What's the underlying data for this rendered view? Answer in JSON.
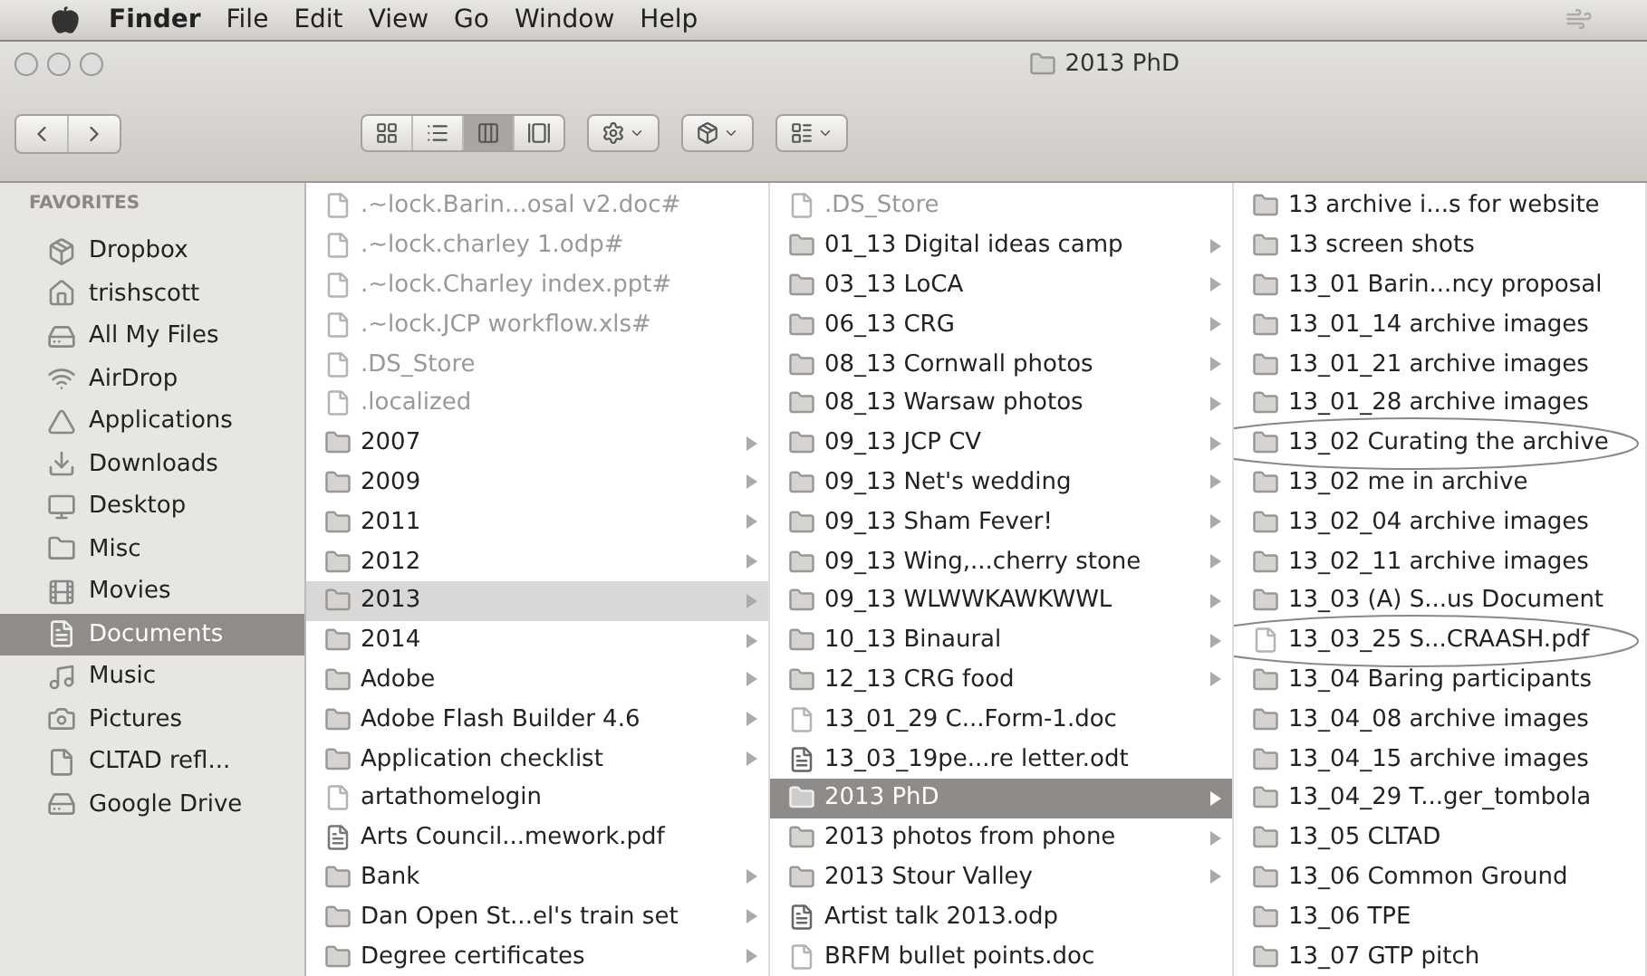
{
  "menu_bar": {
    "items": [
      {
        "label": "Finder",
        "kind": "app"
      },
      {
        "label": "File",
        "kind": "menu"
      },
      {
        "label": "Edit",
        "kind": "menu"
      },
      {
        "label": "View",
        "kind": "menu"
      },
      {
        "label": "Go",
        "kind": "menu"
      },
      {
        "label": "Window",
        "kind": "menu"
      },
      {
        "label": "Help",
        "kind": "menu"
      }
    ]
  },
  "window": {
    "title": "2013 PhD"
  },
  "toolbar": {
    "view_modes": [
      {
        "selected": false
      },
      {
        "selected": false
      },
      {
        "selected": true
      },
      {
        "selected": false
      }
    ]
  },
  "sidebar": {
    "heading": "FAVORITES",
    "items": [
      {
        "label": "Dropbox",
        "selected": false
      },
      {
        "label": "trishscott",
        "selected": false
      },
      {
        "label": "All My Files",
        "selected": false
      },
      {
        "label": "AirDrop",
        "selected": false
      },
      {
        "label": "Applications",
        "selected": false
      },
      {
        "label": "Downloads",
        "selected": false
      },
      {
        "label": "Desktop",
        "selected": false
      },
      {
        "label": "Misc",
        "selected": false
      },
      {
        "label": "Movies",
        "selected": false
      },
      {
        "label": "Documents",
        "selected": true
      },
      {
        "label": "Music",
        "selected": false
      },
      {
        "label": "Pictures",
        "selected": false
      },
      {
        "label": "CLTAD refl...",
        "selected": false
      },
      {
        "label": "Google Drive",
        "selected": false
      }
    ]
  },
  "columns": [
    {
      "focused": false,
      "items": [
        {
          "name": ".~lock.Barin...osal v2.doc#",
          "kind": "file",
          "dimmed": true,
          "selected": false
        },
        {
          "name": ".~lock.charley 1.odp#",
          "kind": "file",
          "dimmed": true,
          "selected": false
        },
        {
          "name": ".~lock.Charley index.ppt#",
          "kind": "file",
          "dimmed": true,
          "selected": false
        },
        {
          "name": ".~lock.JCP workflow.xls#",
          "kind": "file",
          "dimmed": true,
          "selected": false
        },
        {
          "name": ".DS_Store",
          "kind": "file",
          "dimmed": true,
          "selected": false
        },
        {
          "name": ".localized",
          "kind": "file",
          "dimmed": true,
          "selected": false
        },
        {
          "name": "2007",
          "kind": "folder",
          "dimmed": false,
          "selected": false
        },
        {
          "name": "2009",
          "kind": "folder",
          "dimmed": false,
          "selected": false
        },
        {
          "name": "2011",
          "kind": "folder",
          "dimmed": false,
          "selected": false
        },
        {
          "name": "2012",
          "kind": "folder",
          "dimmed": false,
          "selected": false
        },
        {
          "name": "2013",
          "kind": "folder",
          "dimmed": false,
          "selected": true
        },
        {
          "name": "2014",
          "kind": "folder",
          "dimmed": false,
          "selected": false
        },
        {
          "name": "Adobe",
          "kind": "folder",
          "dimmed": false,
          "selected": false
        },
        {
          "name": "Adobe Flash Builder 4.6",
          "kind": "folder",
          "dimmed": false,
          "selected": false
        },
        {
          "name": "Application checklist",
          "kind": "folder",
          "dimmed": false,
          "selected": false
        },
        {
          "name": "artathomelogin",
          "kind": "file",
          "dimmed": false,
          "selected": false
        },
        {
          "name": "Arts Council...mework.pdf",
          "kind": "pdf",
          "dimmed": false,
          "selected": false
        },
        {
          "name": "Bank",
          "kind": "folder",
          "dimmed": false,
          "selected": false
        },
        {
          "name": "Dan Open St...el's train set",
          "kind": "folder",
          "dimmed": false,
          "selected": false
        },
        {
          "name": "Degree certificates",
          "kind": "folder",
          "dimmed": false,
          "selected": false
        }
      ]
    },
    {
      "focused": true,
      "items": [
        {
          "name": ".DS_Store",
          "kind": "file",
          "dimmed": true,
          "selected": false
        },
        {
          "name": "01_13 Digital ideas camp",
          "kind": "folder",
          "dimmed": false,
          "selected": false
        },
        {
          "name": "03_13 LoCA",
          "kind": "folder",
          "dimmed": false,
          "selected": false
        },
        {
          "name": "06_13 CRG",
          "kind": "folder",
          "dimmed": false,
          "selected": false
        },
        {
          "name": "08_13 Cornwall photos",
          "kind": "folder",
          "dimmed": false,
          "selected": false
        },
        {
          "name": "08_13 Warsaw photos",
          "kind": "folder",
          "dimmed": false,
          "selected": false
        },
        {
          "name": "09_13 JCP CV",
          "kind": "folder",
          "dimmed": false,
          "selected": false
        },
        {
          "name": "09_13 Net's wedding",
          "kind": "folder",
          "dimmed": false,
          "selected": false
        },
        {
          "name": "09_13 Sham Fever!",
          "kind": "folder",
          "dimmed": false,
          "selected": false
        },
        {
          "name": "09_13 Wing,...cherry stone",
          "kind": "folder",
          "dimmed": false,
          "selected": false
        },
        {
          "name": "09_13 WLWWKAWKWWL",
          "kind": "folder",
          "dimmed": false,
          "selected": false
        },
        {
          "name": "10_13 Binaural",
          "kind": "folder",
          "dimmed": false,
          "selected": false
        },
        {
          "name": "12_13 CRG food",
          "kind": "folder",
          "dimmed": false,
          "selected": false
        },
        {
          "name": "13_01_29 C...Form-1.doc",
          "kind": "file",
          "dimmed": false,
          "selected": false
        },
        {
          "name": "13_03_19pe...re letter.odt",
          "kind": "office",
          "dimmed": false,
          "selected": false
        },
        {
          "name": "2013 PhD",
          "kind": "folder",
          "dimmed": false,
          "selected": true
        },
        {
          "name": "2013 photos from phone",
          "kind": "folder",
          "dimmed": false,
          "selected": false
        },
        {
          "name": "2013 Stour Valley",
          "kind": "folder",
          "dimmed": false,
          "selected": false
        },
        {
          "name": "Artist talk 2013.odp",
          "kind": "office",
          "dimmed": false,
          "selected": false
        },
        {
          "name": "BRFM bullet points.doc",
          "kind": "file",
          "dimmed": false,
          "selected": false
        }
      ]
    },
    {
      "items": [
        {
          "name": "13 archive i...s for website",
          "kind": "folder",
          "selected": false,
          "circled": false
        },
        {
          "name": "13 screen shots",
          "kind": "folder",
          "selected": false,
          "circled": false
        },
        {
          "name": "13_01 Barin...ncy proposal",
          "kind": "folder",
          "selected": false,
          "circled": false
        },
        {
          "name": "13_01_14 archive images",
          "kind": "folder",
          "selected": false,
          "circled": false
        },
        {
          "name": "13_01_21 archive images",
          "kind": "folder",
          "selected": false,
          "circled": false
        },
        {
          "name": "13_01_28 archive images",
          "kind": "folder",
          "selected": false,
          "circled": false
        },
        {
          "name": "13_02 Curating the archive",
          "kind": "folder",
          "selected": false,
          "circled": true
        },
        {
          "name": "13_02 me in archive",
          "kind": "folder",
          "selected": false,
          "circled": false
        },
        {
          "name": "13_02_04 archive images",
          "kind": "folder",
          "selected": false,
          "circled": false
        },
        {
          "name": "13_02_11 archive images",
          "kind": "folder",
          "selected": false,
          "circled": false
        },
        {
          "name": "13_03 (A) S...us Document",
          "kind": "folder",
          "selected": false,
          "circled": false
        },
        {
          "name": "13_03_25 S...CRAASH.pdf",
          "kind": "file",
          "selected": false,
          "circled": true
        },
        {
          "name": "13_04 Baring participants",
          "kind": "folder",
          "selected": false,
          "circled": false
        },
        {
          "name": "13_04_08 archive images",
          "kind": "folder",
          "selected": false,
          "circled": false
        },
        {
          "name": "13_04_15 archive images",
          "kind": "folder",
          "selected": false,
          "circled": false
        },
        {
          "name": "13_04_29 T...ger_tombola",
          "kind": "folder",
          "selected": false,
          "circled": false
        },
        {
          "name": "13_05 CLTAD",
          "kind": "folder",
          "selected": false,
          "circled": false
        },
        {
          "name": "13_06 Common Ground",
          "kind": "folder",
          "selected": false,
          "circled": false
        },
        {
          "name": "13_06 TPE",
          "kind": "folder",
          "selected": false,
          "circled": false
        },
        {
          "name": "13_07 GTP pitch",
          "kind": "folder",
          "selected": false,
          "circled": false
        }
      ]
    }
  ]
}
